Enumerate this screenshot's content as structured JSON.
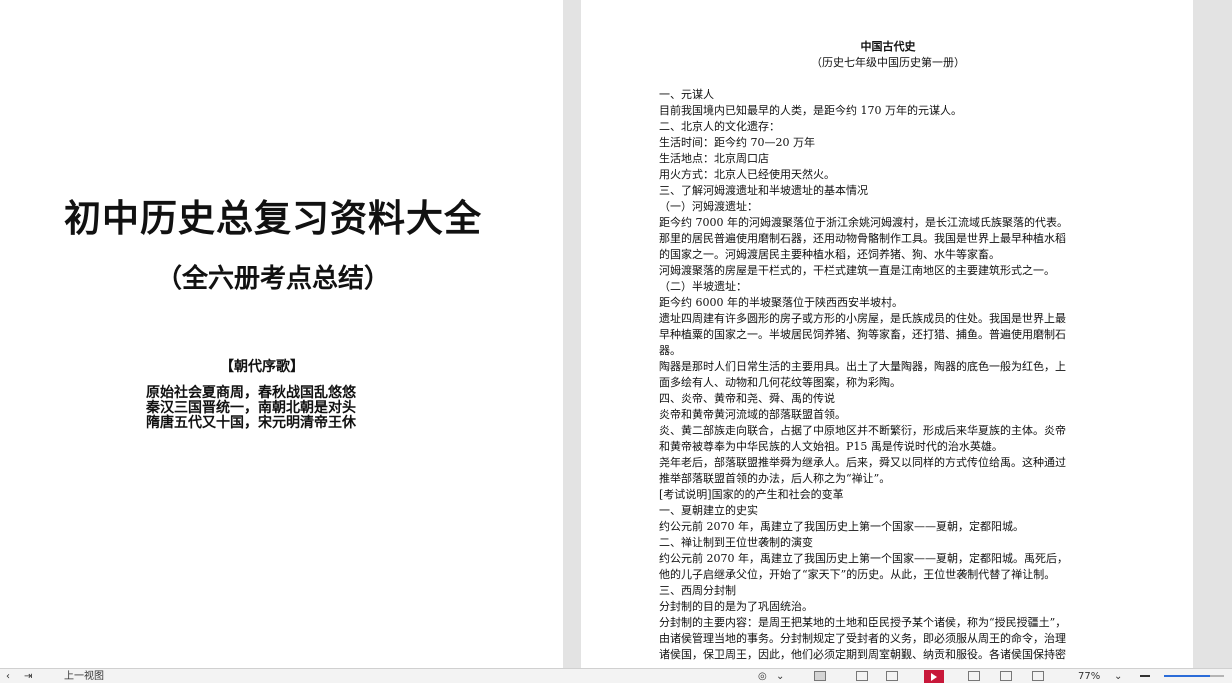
{
  "left_page": {
    "title": "初中历史总复习资料大全",
    "subtitle": "（全六册考点总结）",
    "song_heading": "【朝代序歌】",
    "song_lines": [
      "原始社会夏商周，春秋战国乱悠悠",
      "秦汉三国晋统一，南朝北朝是对头",
      "隋唐五代又十国，宋元明清帝王休"
    ]
  },
  "right_page": {
    "title": "中国古代史",
    "subtitle": "（历史七年级中国历史第一册）",
    "lines": [
      "一、元谋人",
      "目前我国境内已知最早的人类，是距今约 170 万年的元谋人。",
      "二、北京人的文化遗存：",
      "生活时间：距今约 70—20 万年",
      "生活地点：北京周口店",
      "用火方式：北京人已经使用天然火。",
      "三、了解河姆渡遗址和半坡遗址的基本情况",
      "（一）河姆渡遗址：",
      "距今约 7000 年的河姆渡聚落位于浙江余姚河姆渡村，是长江流域氏族聚落的代表。",
      "那里的居民普遍使用磨制石器，还用动物骨骼制作工具。我国是世界上最早种植水稻",
      "的国家之一。河姆渡居民主要种植水稻，还饲养猪、狗、水牛等家畜。",
      "河姆渡聚落的房屋是干栏式的，干栏式建筑一直是江南地区的主要建筑形式之一。",
      "（二）半坡遗址：",
      "距今约 6000 年的半坡聚落位于陕西西安半坡村。",
      "遗址四周建有许多圆形的房子或方形的小房屋，是氏族成员的住处。我国是世界上最",
      "早种植粟的国家之一。半坡居民饲养猪、狗等家畜，还打猎、捕鱼。普遍使用磨制石",
      "器。",
      "陶器是那时人们日常生活的主要用具。出土了大量陶器，陶器的底色一般为红色，上",
      "面多绘有人、动物和几何花纹等图案，称为彩陶。",
      "四、炎帝、黄帝和尧、舜、禹的传说",
      "炎帝和黄帝黄河流域的部落联盟首领。",
      "炎、黄二部族走向联合，占据了中原地区并不断繁衍，形成后来华夏族的主体。炎帝",
      "和黄帝被尊奉为中华民族的人文始祖。P15 禹是传说时代的治水英雄。",
      "尧年老后，部落联盟推举舜为继承人。后来，舜又以同样的方式传位给禹。这种通过",
      "推举部落联盟首领的办法，后人称之为“禅让”。",
      "[考试说明]国家的的产生和社会的变革",
      "一、夏朝建立的史实",
      "约公元前 2070 年，禹建立了我国历史上第一个国家——夏朝，定都阳城。",
      "二、禅让制到王位世袭制的演变",
      "约公元前 2070 年，禹建立了我国历史上第一个国家——夏朝，定都阳城。禹死后，",
      "他的儿子启继承父位，开始了“家天下”的历史。从此，王位世袭制代替了禅让制。",
      "三、西周分封制",
      "分封制的目的是为了巩固统治。",
      "分封制的主要内容：是周王把某地的土地和臣民授予某个诸侯，称为“授民授疆土”，",
      "由诸侯管理当地的事务。分封制规定了受封者的义务，即必须服从周王的命令，治理",
      "诸侯国，保卫周王，因此，他们必须定期到周室朝觐、纳贡和服役。各诸侯国保持密"
    ]
  },
  "statusbar": {
    "nav_label": "上一视图",
    "zoom_level": "77%",
    "zoom_fraction": 0.77,
    "colors": {
      "accent": "#2b6cd8",
      "record_red": "#c8183a"
    }
  }
}
